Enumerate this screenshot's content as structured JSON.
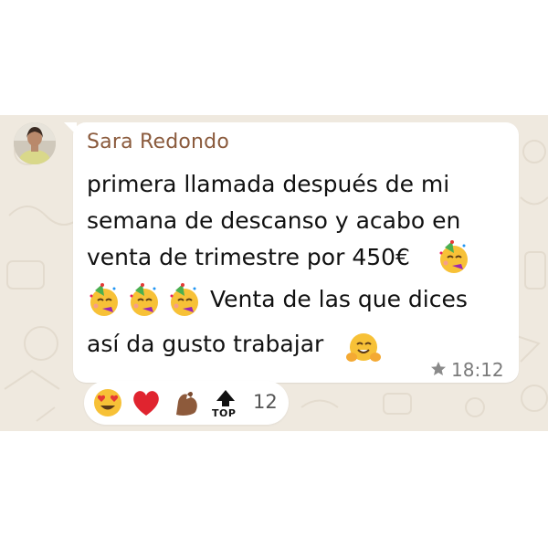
{
  "message": {
    "sender_name": "Sara Redondo",
    "lines": [
      "primera llamada después de mi",
      "semana de descanso y acabo en",
      "venta de trimestre por 450€",
      "Venta de las que dices",
      "así da gusto trabajar"
    ],
    "emojis": [
      "partying-face",
      "partying-face",
      "partying-face",
      "partying-face",
      "hugging-face"
    ],
    "starred": true,
    "time": "18:12"
  },
  "reactions": {
    "items": [
      "heart-eyes",
      "red-heart",
      "flexed-biceps",
      "top-arrow"
    ],
    "top_label": "TOP",
    "count": "12"
  },
  "colors": {
    "sender_name": "#8a5a3c",
    "chat_background": "#efe9df",
    "bubble": "#ffffff"
  }
}
